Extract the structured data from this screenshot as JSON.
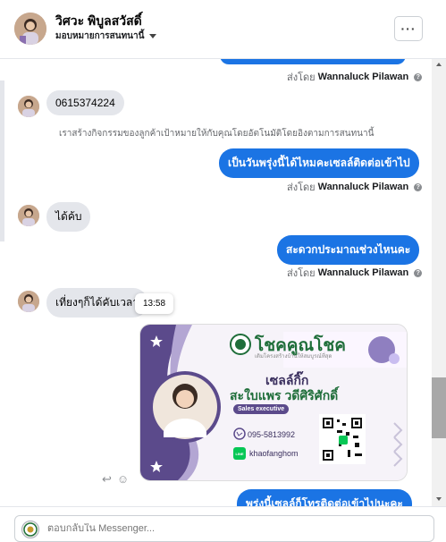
{
  "header": {
    "contact_name": "วิศวะ พิบูลสวัสดิ์",
    "assign_label": "มอบหมายการสนทนานี้",
    "more_label": "···"
  },
  "messages": {
    "top_sent_by_prefix": "ส่งโดย",
    "top_sent_by_name": "Wannaluck Pilawan",
    "phone_in": "0615374224",
    "system_note": "เราสร้างกิจกรรมของลูกค้าเป้าหมายให้กับคุณโดยอัตโนมัติโดยอิงตามการสนทนานี้",
    "out_1": "เป็นวันพรุ่งนี้ได้ไหมคะเซลล์ติดต่อเข้าไป",
    "sent_by_1_prefix": "ส่งโดย",
    "sent_by_1_name": "Wannaluck Pilawan",
    "in_2": "ได้ค้บ",
    "out_2": "สะดวกประมาณช่วงไหนคะ",
    "sent_by_2_prefix": "ส่งโดย",
    "sent_by_2_name": "Wannaluck Pilawan",
    "in_3": "เที่ยงๆก็ได้คับเวลา",
    "tooltip_time": "13:58",
    "out_3": "พรุ่งนี้เซลล์ก็โทรติดต่อเข้าไปนะคะ"
  },
  "card": {
    "brand": "โชคคูณโชค",
    "tagline": "เติมโครงสร้างบ้านให้สมบูรณ์ที่สุด",
    "role_th": "เซลล์กิ๊ก",
    "person_name": "สะใบแพร วดีศิริศักดิ์",
    "role_en": "Sales executive",
    "phone": "095-5813992",
    "line_label": "LINE",
    "line_id": "khaofanghom"
  },
  "composer": {
    "placeholder": "ตอบกลับใน Messenger..."
  },
  "colors": {
    "accent": "#1b74e4",
    "card_purple": "#5b4a8b",
    "card_green": "#1f6e3a"
  },
  "icons": {
    "reply": "reply-icon",
    "react": "smiley-icon",
    "help": "help-icon"
  }
}
